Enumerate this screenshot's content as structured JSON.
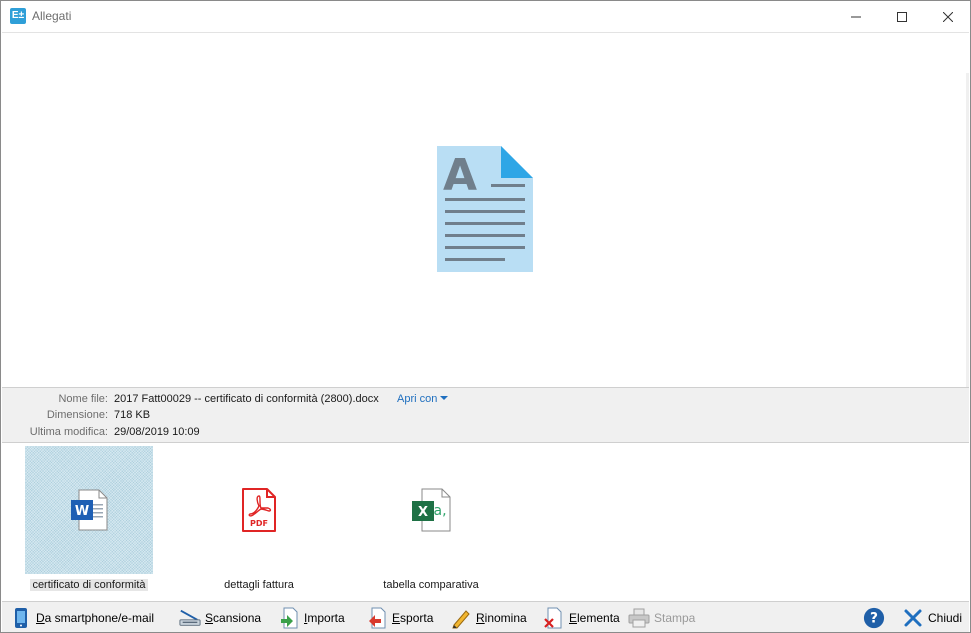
{
  "window": {
    "app_icon_text": "E±",
    "title": "Allegati"
  },
  "info": {
    "file_name_label": "Nome file:",
    "file_name": "2017 Fatt00029 -- certificato di conformità (2800).docx",
    "open_with": "Apri con",
    "size_label": "Dimensione:",
    "size": "718 KB",
    "modified_label": "Ultima modifica:",
    "modified": "29/08/2019 10:09"
  },
  "files": [
    {
      "name": "certificato di conformità",
      "type": "word",
      "selected": true
    },
    {
      "name": "dettagli fattura",
      "type": "pdf",
      "selected": false
    },
    {
      "name": "tabella comparativa",
      "type": "excel",
      "selected": false
    }
  ],
  "toolbar": {
    "smartphone": {
      "first": "D",
      "rest": "a smartphone/e-mail"
    },
    "scan": {
      "first": "S",
      "rest": "cansiona"
    },
    "import": {
      "first": "I",
      "rest": "mporta"
    },
    "export": {
      "first": "E",
      "rest": "sporta"
    },
    "rename": {
      "first": "R",
      "rest": "inomina"
    },
    "delete": {
      "first": "E",
      "rest": "lementa"
    },
    "print": "Stampa",
    "close": "Chiudi"
  },
  "colors": {
    "accent": "#1f6fbf",
    "word": "#1e5fb4",
    "pdf": "#e02525",
    "excel": "#1e7145"
  }
}
